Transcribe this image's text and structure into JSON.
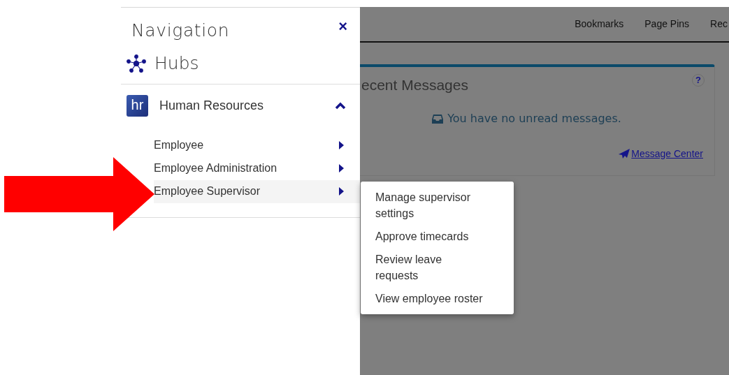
{
  "navigation": {
    "title": "Navigation",
    "close": "×",
    "hubs": "Hubs",
    "module": {
      "name": "Human Resources",
      "logo": "hr",
      "expanded": true
    },
    "items": [
      {
        "label": "Employee",
        "selected": false
      },
      {
        "label": "Employee Administration",
        "selected": false
      },
      {
        "label": "Employee Supervisor",
        "selected": true
      }
    ]
  },
  "submenu": [
    "Manage supervisor settings",
    "Approve timecards",
    "Review leave requests",
    "View employee roster"
  ],
  "top_links": [
    "Bookmarks",
    "Page Pins",
    "Rec"
  ],
  "card": {
    "title": "ecent Messages",
    "help": "?",
    "message": "You have no unread messages.",
    "link": "Message Center"
  }
}
